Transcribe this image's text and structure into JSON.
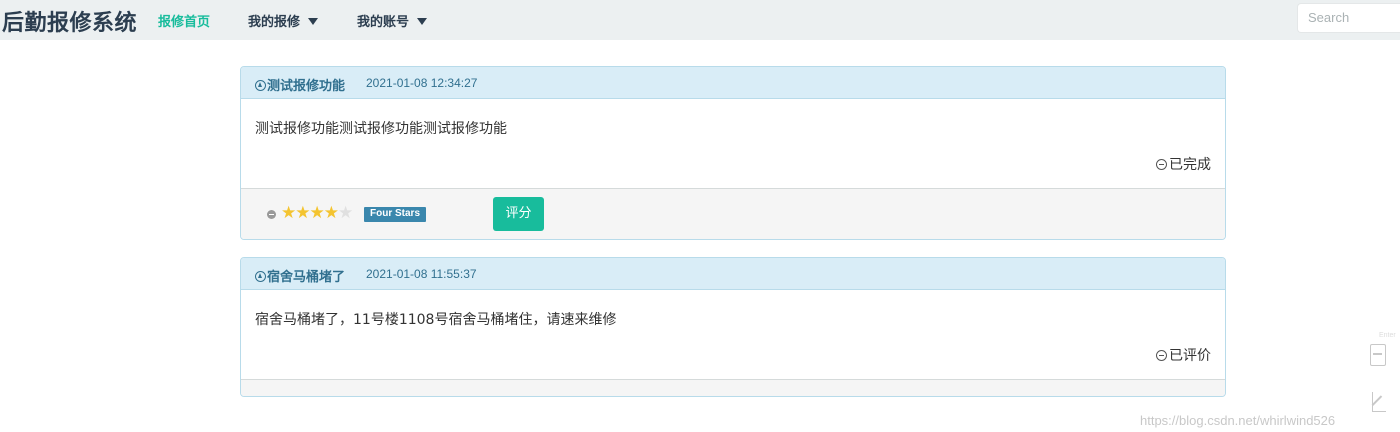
{
  "navbar": {
    "brand": "后勤报修系统",
    "items": [
      {
        "label": "报修首页",
        "active": true,
        "dropdown": false
      },
      {
        "label": "我的报修",
        "active": false,
        "dropdown": true
      },
      {
        "label": "我的账号",
        "active": false,
        "dropdown": true
      }
    ],
    "search": {
      "placeholder": "Search"
    }
  },
  "repairs": [
    {
      "title": "测试报修功能",
      "time": "2021-01-08 12:34:27",
      "content": "测试报修功能测试报修功能测试报修功能",
      "status": "已完成",
      "rating": {
        "value": 4,
        "max": 5,
        "caption": "Four Stars"
      },
      "rate_button": "评分"
    },
    {
      "title": "宿舍马桶堵了",
      "time": "2021-01-08 11:55:37",
      "content": "宿舍马桶堵了，11号楼1108号宿舍马桶堵住，请速来维修",
      "status": "已评价"
    }
  ],
  "watermark": "https://blog.csdn.net/whirlwind526",
  "side_tab": {
    "label": "Enter"
  },
  "colors": {
    "accent": "#18bc9c",
    "navbar_bg": "#ecf0f1",
    "panel_heading": "#d9edf7",
    "panel_title": "#31708f",
    "caption_bg": "#3a87ad"
  }
}
